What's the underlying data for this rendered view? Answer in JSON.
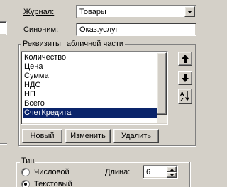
{
  "header": {
    "journal_label": "Журнал:",
    "journal_value": "Товары",
    "synonym_label": "Синоним:",
    "synonym_value": "Оказ.услуг"
  },
  "requisites": {
    "title": "Реквизиты табличной части",
    "items": [
      {
        "label": "Количество"
      },
      {
        "label": "Цена"
      },
      {
        "label": "Сумма"
      },
      {
        "label": "НДС"
      },
      {
        "label": "НП"
      },
      {
        "label": "Всего"
      },
      {
        "label": "СчетКредита"
      }
    ],
    "selected_index": 6,
    "buttons": {
      "new": "Новый",
      "edit": "Изменить",
      "delete": "Удалить"
    },
    "side_icons": [
      "arrow-up-icon",
      "arrow-down-icon",
      "sort-az-icon"
    ]
  },
  "type_group": {
    "title": "Тип",
    "options": [
      {
        "label": "Числовой",
        "checked": false
      },
      {
        "label": "Текстовый",
        "checked": true
      }
    ],
    "length_label": "Длина:",
    "length_value": "6"
  },
  "colors": {
    "window_bg": "#d4d0c8",
    "selection": "#0a246a"
  }
}
